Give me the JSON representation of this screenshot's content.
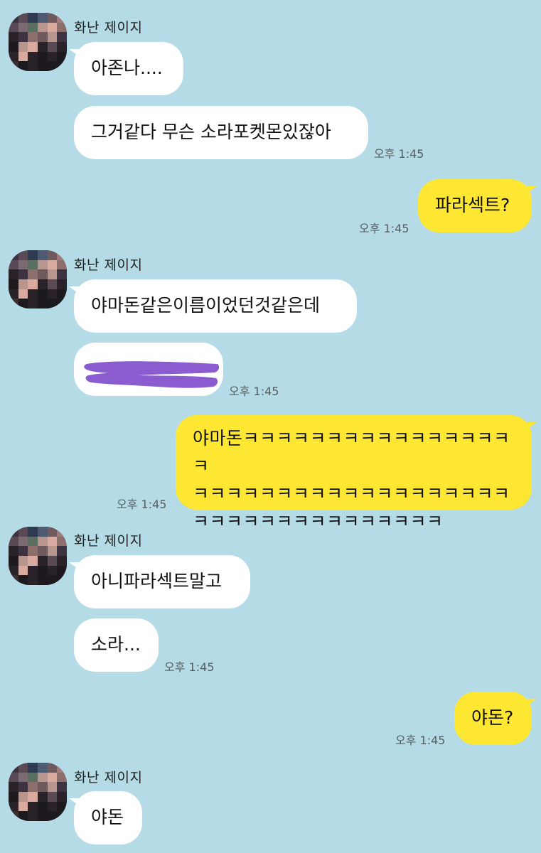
{
  "chat": {
    "colors": {
      "background": "#b4dbe6",
      "incoming_bubble": "#ffffff",
      "outgoing_bubble": "#fee733",
      "redaction": "#8a5ccf"
    },
    "sender_name": "화난 제이지",
    "messages": [
      {
        "side": "in",
        "text": "아존나...."
      },
      {
        "side": "in",
        "text": "그거같다 무슨 소라포켓몬있잖아",
        "time": "오후 1:45"
      },
      {
        "side": "out",
        "text": "파라섹트?",
        "time": "오후 1:45"
      },
      {
        "side": "in",
        "text": "야마돈같은이름이었던것같은데"
      },
      {
        "side": "in",
        "text": "",
        "redacted": true,
        "time": "오후 1:45"
      },
      {
        "side": "out",
        "lines": [
          "야마돈ㅋㅋㅋㅋㅋㅋㅋㅋㅋㅋㅋㅋㅋㅋㅋㅋㅋ",
          "ㅋㅋㅋㅋㅋㅋㅋㅋㅋㅋㅋㅋㅋㅋㅋㅋㅋㅋㅋ",
          "ㅋㅋㅋㅋㅋㅋㅋㅋㅋㅋㅋㅋㅋㅋㅋ"
        ],
        "time": "오후 1:45"
      },
      {
        "side": "in",
        "text": "아니파라섹트말고"
      },
      {
        "side": "in",
        "text": "소라...",
        "time": "오후 1:45"
      },
      {
        "side": "out",
        "text": "야돈?",
        "time": "오후 1:45"
      },
      {
        "side": "in",
        "text": "야돈"
      }
    ]
  }
}
